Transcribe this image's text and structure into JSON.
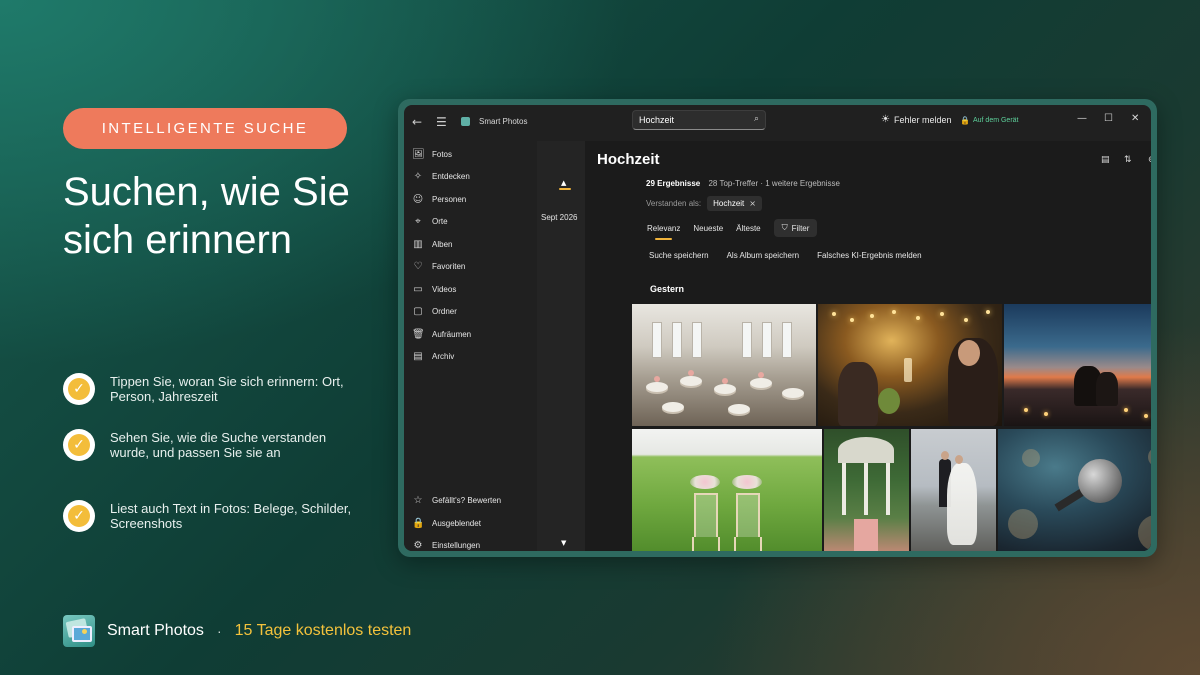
{
  "promo": {
    "badge": "INTELLIGENTE SUCHE",
    "headline": "Suchen, wie Sie sich erinnern",
    "features": [
      "Tippen Sie, woran Sie sich erinnern: Ort, Person, Jahreszeit",
      "Sehen Sie, wie die Suche verstanden wurde, und passen Sie sie an",
      "Liest auch Text in Fotos: Belege, Schilder, Screenshots"
    ],
    "brand_name": "Smart Photos",
    "separator": "·",
    "cta": "15 Tage kostenlos testen",
    "colors": {
      "badge": "#ee7a5c",
      "cta": "#f3c23c",
      "check": "#f3bd3a"
    }
  },
  "app": {
    "title": "Smart Photos",
    "search_value": "Hochzeit",
    "report_label": "Fehler melden",
    "device_label": "Auf dem Gerät",
    "icons": {
      "back": "←",
      "menu": "☰",
      "search": "⌕",
      "bug": "☀",
      "lock": "🔒",
      "minimize": "—",
      "maximize": "☐",
      "close": "✕"
    },
    "nav": [
      {
        "label": "Fotos",
        "icon": "🖼"
      },
      {
        "label": "Entdecken",
        "icon": "✧"
      },
      {
        "label": "Personen",
        "icon": "☺"
      },
      {
        "label": "Orte",
        "icon": "⌖"
      },
      {
        "label": "Alben",
        "icon": "▥"
      },
      {
        "label": "Favoriten",
        "icon": "♡"
      },
      {
        "label": "Videos",
        "icon": "▭"
      },
      {
        "label": "Ordner",
        "icon": "▢"
      },
      {
        "label": "Aufräumen",
        "icon": "🗑"
      },
      {
        "label": "Archiv",
        "icon": "▤"
      }
    ],
    "nav_bottom": [
      {
        "label": "Gefällt's? Bewerten",
        "icon": "☆"
      },
      {
        "label": "Ausgeblendet",
        "icon": "🔒"
      },
      {
        "label": "Einstellungen",
        "icon": "⚙"
      }
    ],
    "timeline": {
      "date": "Sept 2026",
      "up": "▲",
      "down": "▼"
    },
    "main": {
      "title": "Hochzeit",
      "results_count": "29 Ergebnisse",
      "results_detail": "28 Top-Treffer · 1 weitere Ergebnisse",
      "understood_label": "Verstanden als:",
      "chip": "Hochzeit",
      "chip_close": "×",
      "sort_tabs": [
        "Relevanz",
        "Neueste",
        "Älteste"
      ],
      "filter_label": "Filter",
      "filter_icon": "⛉",
      "actions": [
        "Suche speichern",
        "Als Album speichern",
        "Falsches KI-Ergebnis melden"
      ],
      "section": "Gestern",
      "tool_icons": [
        "▤",
        "⇅",
        "⊖",
        "⊕"
      ]
    }
  }
}
